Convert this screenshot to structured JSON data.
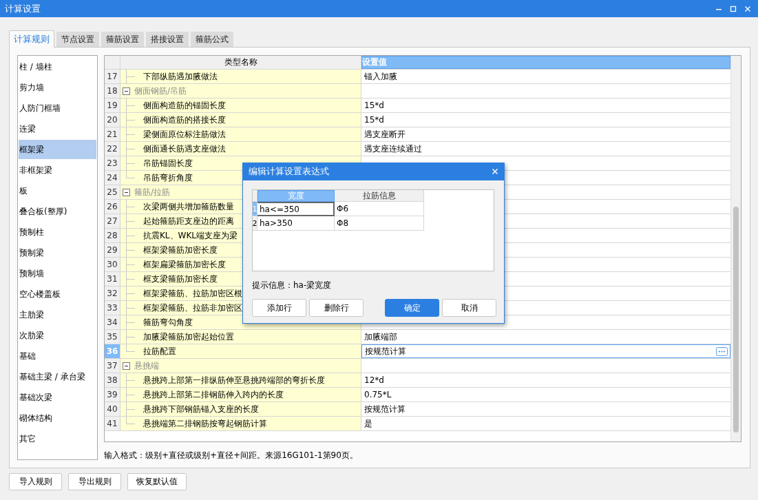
{
  "window": {
    "title": "计算设置"
  },
  "tabs": [
    {
      "label": "计算规则",
      "selected": true
    },
    {
      "label": "节点设置",
      "selected": false
    },
    {
      "label": "箍筋设置",
      "selected": false
    },
    {
      "label": "搭接设置",
      "selected": false
    },
    {
      "label": "箍筋公式",
      "selected": false
    }
  ],
  "sidebar": {
    "items": [
      {
        "label": "柱 / 墙柱",
        "selected": false
      },
      {
        "label": "剪力墙",
        "selected": false
      },
      {
        "label": "人防门框墙",
        "selected": false
      },
      {
        "label": "连梁",
        "selected": false
      },
      {
        "label": "框架梁",
        "selected": true
      },
      {
        "label": "非框架梁",
        "selected": false
      },
      {
        "label": "板",
        "selected": false
      },
      {
        "label": "叠合板(整厚)",
        "selected": false
      },
      {
        "label": "预制柱",
        "selected": false
      },
      {
        "label": "预制梁",
        "selected": false
      },
      {
        "label": "预制墙",
        "selected": false
      },
      {
        "label": "空心楼盖板",
        "selected": false
      },
      {
        "label": "主肋梁",
        "selected": false
      },
      {
        "label": "次肋梁",
        "selected": false
      },
      {
        "label": "基础",
        "selected": false
      },
      {
        "label": "基础主梁 / 承台梁",
        "selected": false
      },
      {
        "label": "基础次梁",
        "selected": false
      },
      {
        "label": "砌体结构",
        "selected": false
      },
      {
        "label": "其它",
        "selected": false
      }
    ]
  },
  "table": {
    "columns": [
      {
        "label": "类型名称",
        "selected": false
      },
      {
        "label": "设置值",
        "selected": true
      }
    ],
    "rows": [
      {
        "num": "17",
        "name": "下部纵筋遇加腋做法",
        "value": "锚入加腋",
        "selected": false
      },
      {
        "num": "18",
        "name": "侧面钢筋/吊筋",
        "expanded": true,
        "selected": false,
        "children": [
          {
            "num": "19",
            "name": "侧面构造筋的锚固长度",
            "value": "15*d",
            "selected": false
          },
          {
            "num": "20",
            "name": "侧面构造筋的搭接长度",
            "value": "15*d",
            "selected": false
          },
          {
            "num": "21",
            "name": "梁侧面原位标注筋做法",
            "value": "遇支座断开",
            "selected": false
          },
          {
            "num": "22",
            "name": "侧面通长筋遇支座做法",
            "value": "遇支座连续通过",
            "selected": false
          },
          {
            "num": "23",
            "name": "吊筋锚固长度",
            "selected": false
          },
          {
            "num": "24",
            "name": "吊筋弯折角度",
            "selected": false
          }
        ]
      },
      {
        "num": "25",
        "name": "箍筋/拉筋",
        "expanded": true,
        "selected": false,
        "children": [
          {
            "num": "26",
            "name": "次梁两侧共增加箍筋数量",
            "selected": false
          },
          {
            "num": "27",
            "name": "起始箍筋距支座边的距离",
            "selected": false
          },
          {
            "num": "28",
            "name": "抗震KL、WKL端支座为梁",
            "selected": false
          },
          {
            "num": "29",
            "name": "框架梁箍筋加密长度",
            "selected": false
          },
          {
            "num": "30",
            "name": "框架扁梁箍筋加密长度",
            "selected": false
          },
          {
            "num": "31",
            "name": "框支梁箍筋加密长度",
            "selected": false
          },
          {
            "num": "32",
            "name": "框架梁箍筋、拉筋加密区根",
            "selected": false
          },
          {
            "num": "33",
            "name": "框架梁箍筋、拉筋非加密区",
            "selected": false
          },
          {
            "num": "34",
            "name": "箍筋弯勾角度",
            "selected": false
          },
          {
            "num": "35",
            "name": "加腋梁箍筋加密起始位置",
            "value": "加腋端部",
            "selected": false
          },
          {
            "num": "36",
            "name": "拉筋配置",
            "value": "按规范计算",
            "selected": true
          }
        ]
      },
      {
        "num": "37",
        "name": "悬挑端",
        "expanded": true,
        "selected": false,
        "children": [
          {
            "num": "38",
            "name": "悬挑跨上部第一排纵筋伸至悬挑跨端部的弯折长度",
            "value": "12*d",
            "selected": false
          },
          {
            "num": "39",
            "name": "悬挑跨上部第二排钢筋伸入跨内的长度",
            "value": "0.75*L",
            "selected": false
          },
          {
            "num": "40",
            "name": "悬挑跨下部钢筋锚入支座的长度",
            "value": "按规范计算",
            "selected": false
          },
          {
            "num": "41",
            "name": "悬挑端第二排钢筋按弯起钢筋计算",
            "value": "是",
            "selected": false
          }
        ]
      }
    ]
  },
  "hint": "输入格式：级别+直径或级别+直径+间距。来源16G101-1第90页。",
  "buttons": [
    "导入规则",
    "导出规则",
    "恢复默认值"
  ],
  "dialog": {
    "title": "编辑计算设置表达式",
    "columns": [
      {
        "label": "宽度",
        "selected": true
      },
      {
        "label": "拉筋信息",
        "selected": false
      }
    ],
    "rows": [
      {
        "num": "1",
        "cells": [
          "ha<=350",
          "Φ6"
        ],
        "selected": true
      },
      {
        "num": "2",
        "cells": [
          "ha>350",
          "Φ8"
        ],
        "selected": false
      }
    ],
    "hint": "提示信息：ha-梁宽度",
    "buttons": [
      {
        "label": "添加行",
        "kind": "normal"
      },
      {
        "label": "删除行",
        "kind": "normal"
      },
      {
        "label": "确定",
        "kind": "primary"
      },
      {
        "label": "取消",
        "kind": "normal"
      }
    ]
  }
}
